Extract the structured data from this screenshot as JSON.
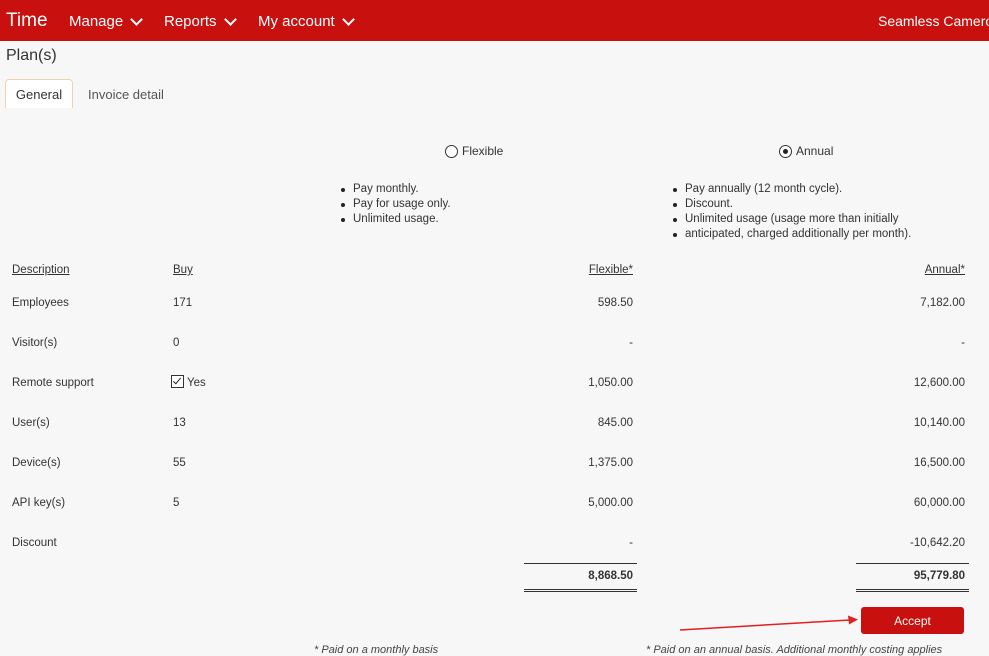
{
  "topbar": {
    "brand": "Time",
    "nav": [
      "Manage",
      "Reports",
      "My account"
    ],
    "user": "Seamless Cameron",
    "color": "#c8100e"
  },
  "page_title": "Plan(s)",
  "tabs": [
    {
      "label": "General",
      "active": true
    },
    {
      "label": "Invoice detail",
      "active": false
    }
  ],
  "plans": {
    "flexible": {
      "label": "Flexible",
      "selected": false,
      "bullets": [
        "Pay monthly.",
        "Pay for usage only.",
        "Unlimited usage."
      ]
    },
    "annual": {
      "label": "Annual",
      "selected": true,
      "bullets": [
        "Pay annually (12 month cycle).",
        "Discount.",
        "Unlimited usage (usage more than initially",
        "anticipated, charged additionally per month)."
      ]
    }
  },
  "table": {
    "headers": {
      "description": "Description",
      "buy": "Buy",
      "flexible": "Flexible*",
      "annual": "Annual*"
    },
    "rows": [
      {
        "description": "Employees",
        "buy": "171",
        "flexible": "598.50",
        "annual": "7,182.00"
      },
      {
        "description": "Visitor(s)",
        "buy": "0",
        "flexible": "-",
        "annual": "-"
      },
      {
        "description": "Remote support",
        "buy": "Yes",
        "checked": true,
        "flexible": "1,050.00",
        "annual": "12,600.00"
      },
      {
        "description": "User(s)",
        "buy": "13",
        "flexible": "845.00",
        "annual": "10,140.00"
      },
      {
        "description": "Device(s)",
        "buy": "55",
        "flexible": "1,375.00",
        "annual": "16,500.00"
      },
      {
        "description": "API key(s)",
        "buy": "5",
        "flexible": "5,000.00",
        "annual": "60,000.00"
      },
      {
        "description": "Discount",
        "buy": "",
        "flexible": "-",
        "annual": "-10,642.20"
      }
    ],
    "totals": {
      "flexible": "8,868.50",
      "annual": "95,779.80"
    }
  },
  "accept_label": "Accept",
  "footnotes": {
    "flexible": "* Paid on a monthly basis",
    "annual": "* Paid on an annual basis. Additional monthly costing applies"
  }
}
